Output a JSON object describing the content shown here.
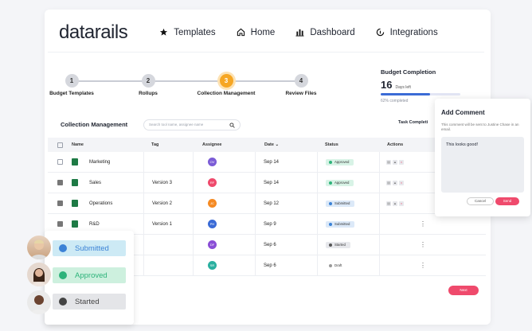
{
  "header": {
    "logo": "datarails",
    "nav": [
      {
        "label": "Templates",
        "icon": "star-icon"
      },
      {
        "label": "Home",
        "icon": "home-icon"
      },
      {
        "label": "Dashboard",
        "icon": "bar-chart-icon"
      },
      {
        "label": "Integrations",
        "icon": "integrations-icon"
      }
    ]
  },
  "stepper": [
    {
      "num": "1",
      "label": "Budget Templates",
      "active": false
    },
    {
      "num": "2",
      "label": "Rollups",
      "active": false
    },
    {
      "num": "3",
      "label": "Collection Management",
      "active": true
    },
    {
      "num": "4",
      "label": "Review Files",
      "active": false
    }
  ],
  "budget": {
    "title": "Budget Completion",
    "days": "16",
    "days_label": "Days left",
    "pct_label": "62% completed",
    "progress": 0.62
  },
  "collection": {
    "title": "Collection Management",
    "search_placeholder": "Search tool name, assignee name",
    "task_label": "Task Completi"
  },
  "table": {
    "columns": [
      "Name",
      "Tag",
      "Assignee",
      "Date",
      "Status",
      "Actions"
    ],
    "rows": [
      {
        "name": "Marketing",
        "tag": "",
        "assignee": "OV",
        "assignee_color": "#7b5cd6",
        "date": "Sep 14",
        "status": "Approved",
        "status_color": "#2db37a",
        "status_bg": "#d8f3e6",
        "checked": false,
        "actions": true
      },
      {
        "name": "Sales",
        "tag": "Version 3",
        "assignee": "RF",
        "assignee_color": "#ef4a6c",
        "date": "Sep 14",
        "status": "Approved",
        "status_color": "#2db37a",
        "status_bg": "#d8f3e6",
        "checked": true,
        "actions": true
      },
      {
        "name": "Operations",
        "tag": "Version 2",
        "assignee": "JC",
        "assignee_color": "#f58a23",
        "date": "Sep 12",
        "status": "Submitted",
        "status_color": "#3b82d6",
        "status_bg": "#dce9f8",
        "checked": true,
        "actions": true
      },
      {
        "name": "R&D",
        "tag": "Version 1",
        "assignee": "PH",
        "assignee_color": "#3b6bd6",
        "date": "Sep 9",
        "status": "Submitted",
        "status_color": "#3b82d6",
        "status_bg": "#dce9f8",
        "checked": true,
        "actions": false
      },
      {
        "name": "",
        "tag": "",
        "assignee": "DF",
        "assignee_color": "#8a4ed6",
        "date": "Sep 6",
        "status": "Started",
        "status_color": "#555",
        "status_bg": "#e7e8ec",
        "checked": false,
        "actions": false
      },
      {
        "name": "",
        "tag": "",
        "assignee": "SR",
        "assignee_color": "#2bb0a0",
        "date": "Sep 6",
        "status": "Draft",
        "status_color": "#999",
        "status_bg": "transparent",
        "checked": false,
        "actions": false
      }
    ]
  },
  "comment": {
    "title": "Add Comment",
    "desc": "This comment will be sent to Justine Chase in an email.",
    "text": "This looks good!",
    "cancel": "Cancel",
    "save": "Send"
  },
  "next": "Next",
  "status_cards": [
    {
      "label": "Submitted",
      "bg": "#cdeaf5",
      "fg": "#3b82d6"
    },
    {
      "label": "Approved",
      "bg": "#cdf0de",
      "fg": "#2db37a"
    },
    {
      "label": "Started",
      "bg": "#e4e5e8",
      "fg": "#444"
    }
  ]
}
